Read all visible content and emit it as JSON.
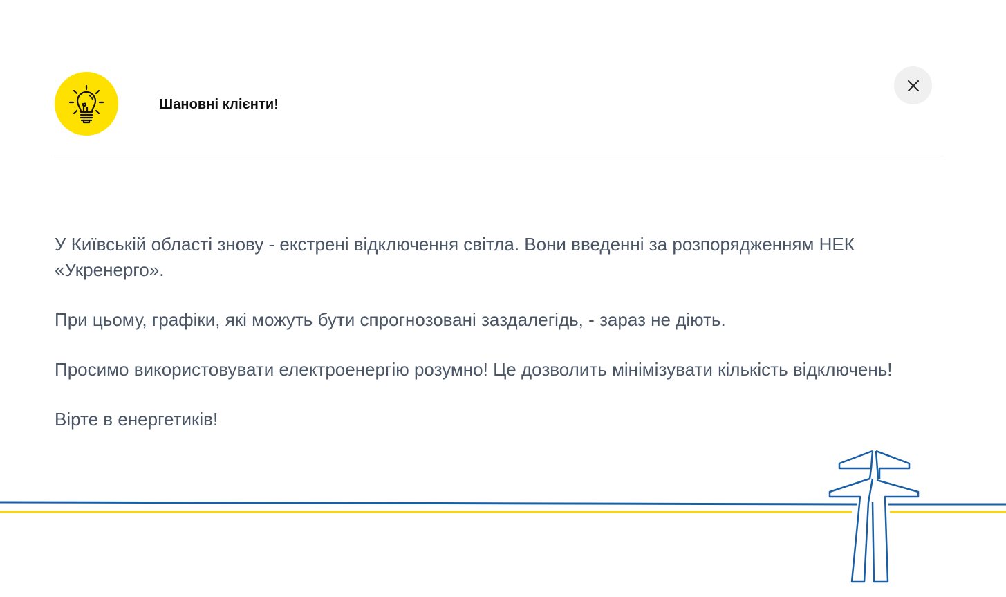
{
  "header": {
    "title": "Шановні клієнти!",
    "icon": "lightbulb-icon",
    "icon_color": "#ffe100"
  },
  "close_button": {
    "icon": "close-icon"
  },
  "message": {
    "paragraphs": [
      "У Київській області знову - екстрені відключення світла. Вони введенні за розпорядженням НЕК «Укренерго».",
      "При цьому, графіки, які можуть бути спрогнозовані заздалегідь, - зараз не діють.",
      "Просимо використовувати електроенергію розумно! Це дозволить мінімізувати кількість відключень!",
      "Вірте в енергетиків!"
    ]
  },
  "decoration": {
    "icon": "power-pylon-icon",
    "line_colors": [
      "#1a5fa3",
      "#ffd500"
    ]
  }
}
